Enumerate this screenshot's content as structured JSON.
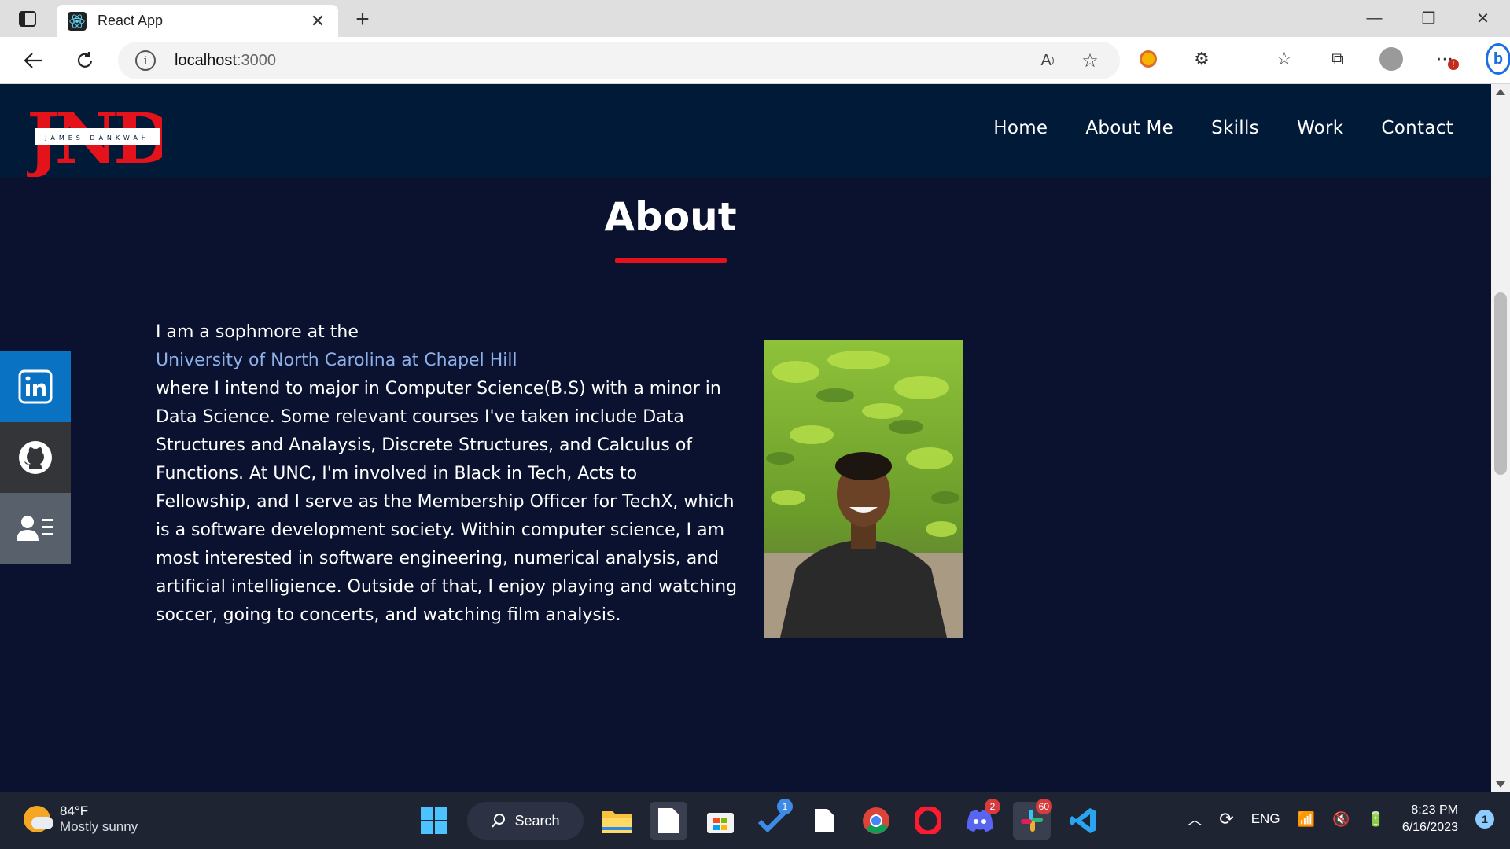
{
  "browser": {
    "tab_title": "React App",
    "url_host": "localhost",
    "url_port": ":3000"
  },
  "site": {
    "logo_letters": "JND",
    "logo_banner": "JAMES DANKWAH",
    "nav": [
      {
        "label": "Home"
      },
      {
        "label": "About Me"
      },
      {
        "label": "Skills"
      },
      {
        "label": "Work"
      },
      {
        "label": "Contact"
      }
    ],
    "about": {
      "title": "About",
      "intro": "I am a sophmore at the",
      "university": "University of North Carolina at Chapel Hill",
      "body": "where I intend to major in Computer Science(B.S) with a minor in Data Science. Some relevant courses I've taken include Data Structures and Analaysis, Discrete Structures, and Calculus of Functions. At UNC, I'm involved in Black in Tech, Acts to Fellowship, and I serve as the Membership Officer for TechX, which is a software development society. Within computer science, I am most interested in software engineering, numerical analysis, and artificial intelligience. Outside of that, I enjoy playing and watching soccer, going to concerts, and watching film analysis."
    },
    "social": [
      "linkedin-icon",
      "github-icon",
      "contact-card-icon"
    ]
  },
  "taskbar": {
    "weather_temp": "84°F",
    "weather_cond": "Mostly sunny",
    "search_label": "Search",
    "badges": {
      "todo": "1",
      "discord": "2",
      "slack": "60"
    },
    "lang": "ENG",
    "time": "8:23 PM",
    "date": "6/16/2023",
    "notifications": "1"
  },
  "colors": {
    "page_bg": "#0a1230",
    "nav_bg": "#011a38",
    "accent_red": "#e3121b",
    "link_blue": "#8eb0e8"
  }
}
